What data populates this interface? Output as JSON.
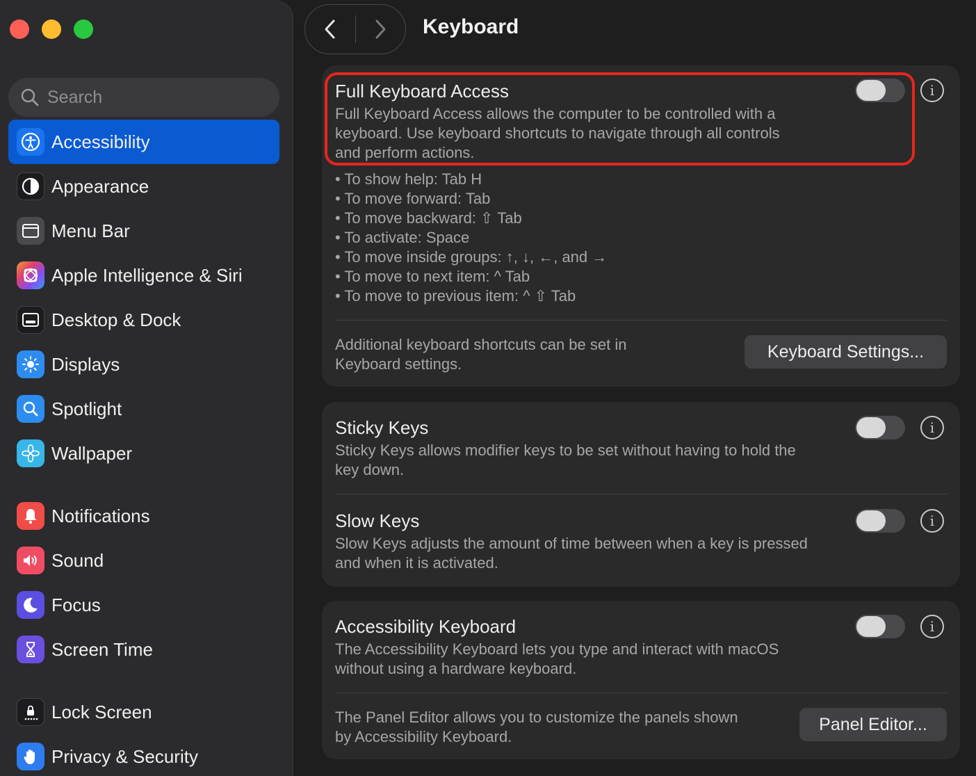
{
  "window": {
    "title": "Keyboard",
    "traffic_lights": {
      "close": "#fe5f57",
      "minimize": "#febc2e",
      "zoom": "#28c840"
    }
  },
  "search": {
    "placeholder": "Search",
    "icon": "magnifier-icon"
  },
  "sidebar": {
    "items": [
      {
        "label": "Accessibility",
        "icon": "accessibility-icon",
        "color": "#1a74f0",
        "active": true
      },
      {
        "label": "Appearance",
        "icon": "appearance-icon",
        "color": "#1c1c1e"
      },
      {
        "label": "Menu Bar",
        "icon": "menu-bar-icon",
        "color": "#3b3b3d"
      },
      {
        "label": "Apple Intelligence & Siri",
        "icon": "siri-icon",
        "color": "#b04ce0"
      },
      {
        "label": "Desktop & Dock",
        "icon": "dock-icon",
        "color": "#1c1c1e"
      },
      {
        "label": "Displays",
        "icon": "displays-icon",
        "color": "#2d8cf0"
      },
      {
        "label": "Spotlight",
        "icon": "spotlight-icon",
        "color": "#2d8cf0"
      },
      {
        "label": "Wallpaper",
        "icon": "wallpaper-icon",
        "color": "#38b6e8"
      },
      {
        "label": "Notifications",
        "icon": "notifications-icon",
        "color": "#f04c48"
      },
      {
        "label": "Sound",
        "icon": "sound-icon",
        "color": "#f04c64"
      },
      {
        "label": "Focus",
        "icon": "focus-icon",
        "color": "#5a4fe0"
      },
      {
        "label": "Screen Time",
        "icon": "screen-time-icon",
        "color": "#6a4fe0"
      },
      {
        "label": "Lock Screen",
        "icon": "lock-screen-icon",
        "color": "#1c1c1e"
      },
      {
        "label": "Privacy & Security",
        "icon": "privacy-hand-icon",
        "color": "#2d7cf0"
      }
    ]
  },
  "full_keyboard_access": {
    "title": "Full Keyboard Access",
    "description_lines": [
      "Full Keyboard Access allows the computer to be controlled with a",
      "keyboard. Use keyboard shortcuts to navigate through all controls",
      "and perform actions."
    ],
    "enabled": false,
    "shortcuts": [
      "To show help: Tab H",
      "To move forward: Tab",
      "To move backward: ⇧ Tab",
      "To activate: Space",
      "To move inside groups: ↑, ↓, ←, and →",
      "To move to next item: ^ Tab",
      "To move to previous item: ^ ⇧ Tab"
    ],
    "additional_lines": [
      "Additional keyboard shortcuts can be set in",
      "Keyboard settings."
    ],
    "settings_button": "Keyboard Settings..."
  },
  "sticky_keys": {
    "title": "Sticky Keys",
    "description_lines": [
      "Sticky Keys allows modifier keys to be set without having to hold the",
      "key down."
    ],
    "enabled": false
  },
  "slow_keys": {
    "title": "Slow Keys",
    "description_lines": [
      "Slow Keys adjusts the amount of time between when a key is pressed",
      "and when it is activated."
    ],
    "enabled": false
  },
  "accessibility_keyboard": {
    "title": "Accessibility Keyboard",
    "description_lines": [
      "The Accessibility Keyboard lets you type and interact with macOS",
      "without using a hardware keyboard."
    ],
    "enabled": false,
    "panel_lines": [
      "The Panel Editor allows you to customize the panels shown",
      "by Accessibility Keyboard."
    ],
    "panel_button": "Panel Editor..."
  },
  "info_glyph": "i",
  "highlight_color": "#e8251c"
}
